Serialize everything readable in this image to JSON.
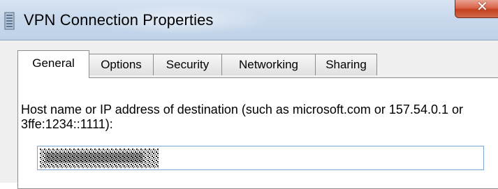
{
  "window": {
    "title": "VPN Connection Properties",
    "icon": "vpn-connection-icon",
    "close_icon": "close-icon",
    "close_color": "#c4411f"
  },
  "tabs": [
    {
      "label": "General",
      "active": true
    },
    {
      "label": "Options",
      "active": false
    },
    {
      "label": "Security",
      "active": false
    },
    {
      "label": "Networking",
      "active": false
    },
    {
      "label": "Sharing",
      "active": false
    }
  ],
  "general": {
    "host_label": "Host name or IP address of destination (such as microsoft.com or 157.54.0.1 or 3ffe:1234::1111):",
    "host_value_obscured": true
  },
  "colors": {
    "titlebar": "#c9d9ec",
    "dialog_bg": "#f0f0f0",
    "input_border": "#7aa6d6"
  }
}
